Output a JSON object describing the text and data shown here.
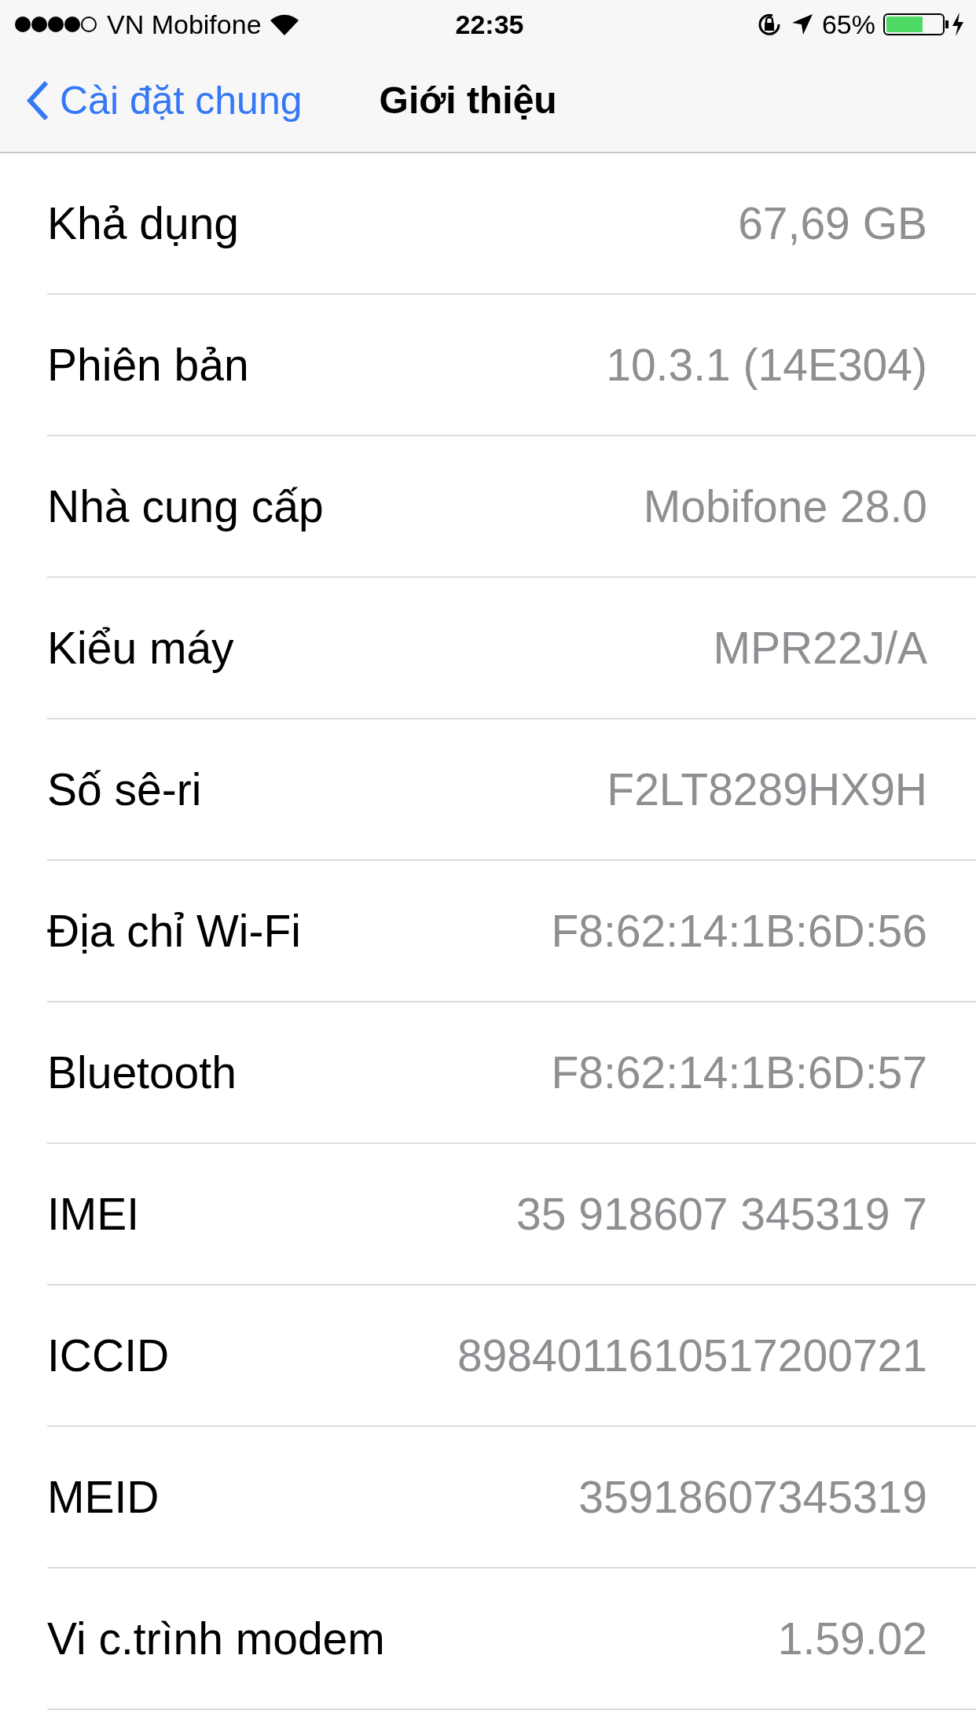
{
  "status_bar": {
    "carrier": "VN Mobifone",
    "time": "22:35",
    "battery": "65%"
  },
  "nav": {
    "back": "Cài đặt chung",
    "title": "Giới thiệu"
  },
  "rows": [
    {
      "label": "Khả dụng",
      "value": "67,69 GB"
    },
    {
      "label": "Phiên bản",
      "value": "10.3.1 (14E304)"
    },
    {
      "label": "Nhà cung cấp",
      "value": "Mobifone 28.0"
    },
    {
      "label": "Kiểu máy",
      "value": "MPR22J/A"
    },
    {
      "label": "Số sê-ri",
      "value": "F2LT8289HX9H"
    },
    {
      "label": "Địa chỉ Wi-Fi",
      "value": "F8:62:14:1B:6D:56"
    },
    {
      "label": "Bluetooth",
      "value": "F8:62:14:1B:6D:57"
    },
    {
      "label": "IMEI",
      "value": "35 918607 345319 7"
    },
    {
      "label": "ICCID",
      "value": "8984011610517200721"
    },
    {
      "label": "MEID",
      "value": "35918607345319"
    },
    {
      "label": "Vi c.trình modem",
      "value": "1.59.02"
    }
  ]
}
